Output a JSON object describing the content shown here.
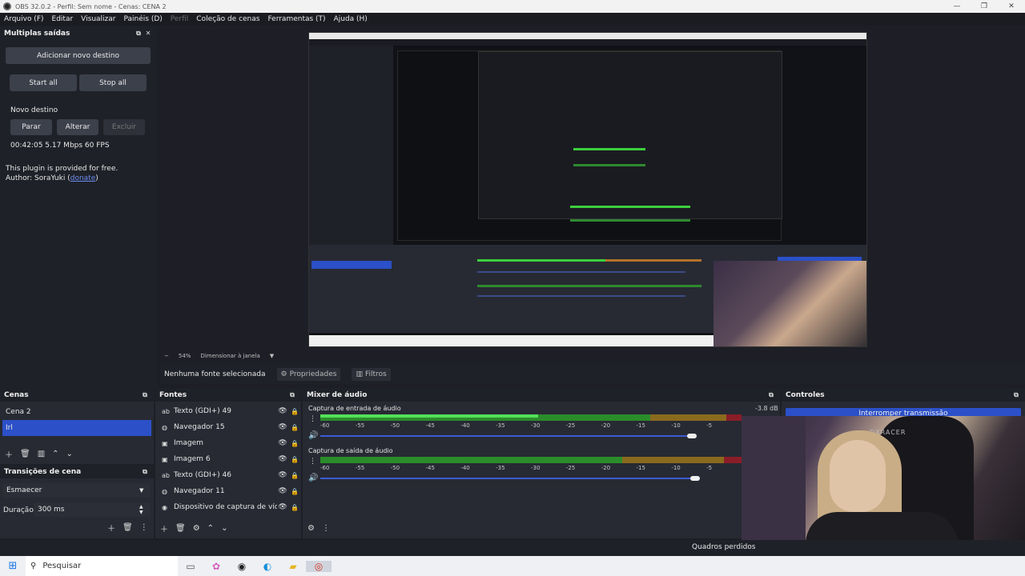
{
  "window": {
    "title": "OBS 32.0.2 - Perfil: Sem nome - Cenas: CENA 2",
    "min": "—",
    "max": "❐",
    "close": "✕"
  },
  "menu": {
    "items": [
      "Arquivo (F)",
      "Editar",
      "Visualizar",
      "Painéis (D)",
      "Perfil",
      "Coleção de cenas",
      "Ferramentas (T)",
      "Ajuda (H)"
    ]
  },
  "multiple_outputs": {
    "title": "Multiplas saídas",
    "add_target": "Adicionar novo destino",
    "start_all": "Start all",
    "stop_all": "Stop all",
    "new_target": "Novo destino",
    "stop": "Parar",
    "edit": "Alterar",
    "delete": "Excluir",
    "stats": "00:42:05  5.17 Mbps  60 FPS",
    "plugin_text": "This plugin is provided for free.",
    "author_prefix": "Author: SoraYuki (",
    "author_link": "donate",
    "author_suffix": ")"
  },
  "preview": {
    "zoom": "54%",
    "zoom_mode": "Dimensionar à janela"
  },
  "source_bar": {
    "no_source": "Nenhuma fonte selecionada",
    "properties": "Propriedades",
    "filters": "Filtros"
  },
  "scenes": {
    "title": "Cenas",
    "items": [
      "Cena 2",
      "Irl"
    ]
  },
  "transitions": {
    "title": "Transições de cena",
    "selected": "Esmaecer",
    "duration_label": "Duração",
    "duration_value": "300 ms"
  },
  "sources": {
    "title": "Fontes",
    "items": [
      {
        "icon": "text-icon",
        "label": "Texto (GDI+) 49"
      },
      {
        "icon": "browser-icon",
        "label": "Navegador 15"
      },
      {
        "icon": "image-icon",
        "label": "Imagem"
      },
      {
        "icon": "image-icon",
        "label": "Imagem 6"
      },
      {
        "icon": "text-icon",
        "label": "Texto (GDI+) 46"
      },
      {
        "icon": "browser-icon",
        "label": "Navegador 11"
      },
      {
        "icon": "capture-device-icon",
        "label": "Dispositivo de captura de vídeo"
      }
    ]
  },
  "mixer": {
    "title": "Mixer de áudio",
    "channels": [
      {
        "name": "Captura de entrada de áudio",
        "db": "-3.8 dB",
        "volume": 0.88
      },
      {
        "name": "Captura de saída de áudio",
        "db": "",
        "volume": 0.89
      }
    ],
    "ticks": [
      "-60",
      "-55",
      "-50",
      "-45",
      "-40",
      "-35",
      "-30",
      "-25",
      "-20",
      "-15",
      "-10",
      "-5"
    ]
  },
  "controls": {
    "title": "Controles",
    "stop_stream": "Interromper transmissão",
    "chair_brand": "DXRACER"
  },
  "status": {
    "dropped": "Quadros perdidos"
  },
  "taskbar": {
    "search": "Pesquisar"
  }
}
